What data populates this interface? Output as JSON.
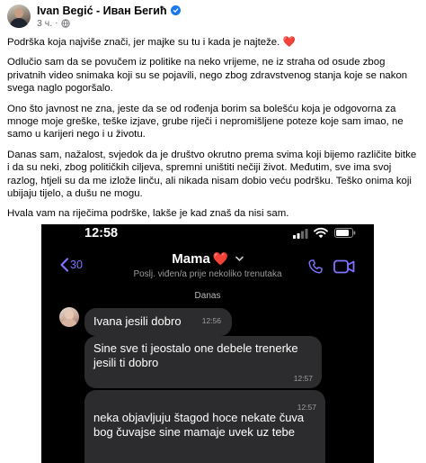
{
  "post": {
    "author": "Ivan Begić - Иван Бегић",
    "time": "3 ч.",
    "separator": "·",
    "paragraphs": [
      "Podrška koja najviše znači, jer majke su tu i kada je najteže.",
      "Odlučio sam da se povučem iz politike na neko vrijeme, ne iz straha od osude zbog privatnih video snimaka koji su se pojavili, nego zbog zdravstvenog stanja koje se nakon svega naglo pogoršalo.",
      "Ono što javnost ne zna, jeste da se od rođenja borim sa bolešću koja je odgovorna za mnoge moje greške, teške izjave, grube riječi i nepromišljene poteze koje sam imao, ne samo u karijeri nego i u životu.",
      "Danas sam, nažalost, svjedok da je društvo okrutno prema svima koji bijemo različite bitke i da su neki, zbog političkih ciljeva, spremni uništiti nečiji život. Međutim, sve ima svoj razlog, htjeli su da me izlože linču, ali nikada nisam dobio veću podršku. Teško onima koji ubijaju tijelo, a dušu ne mogu.",
      "Hvala vam na riječima podrške, lakše je kad znaš da nisi sam."
    ],
    "first_paragraph_emoji": "❤️"
  },
  "phone": {
    "clock": "12:58",
    "back_count": "30",
    "contact_name": "Mama",
    "contact_emoji": "❤️",
    "last_seen": "Poslj. viđen/a prije nekoliko trenutaka",
    "date_label": "Danas",
    "messages": [
      {
        "text": "Ivana jesili dobro",
        "time": "12:56"
      },
      {
        "text": "Sine sve ti jeostalo one debele trenerke jesili ti dobro",
        "time": "12:57"
      },
      {
        "text": "neka objavljuju štagod hoce nekate čuva bog čuvajse sine mamaje uvek uz tebe",
        "time": "12:57"
      }
    ]
  },
  "colors": {
    "facebook_blue": "#1877f2",
    "heart_red": "#e41e3f",
    "viber_purple": "#7f73ff",
    "bubble_gray": "#2c2c2e"
  },
  "icons": [
    "verified-icon",
    "globe-icon",
    "signal-icon",
    "wifi-icon",
    "battery-icon",
    "back-chevron-icon",
    "chevron-down-icon",
    "phone-icon",
    "video-icon"
  ]
}
